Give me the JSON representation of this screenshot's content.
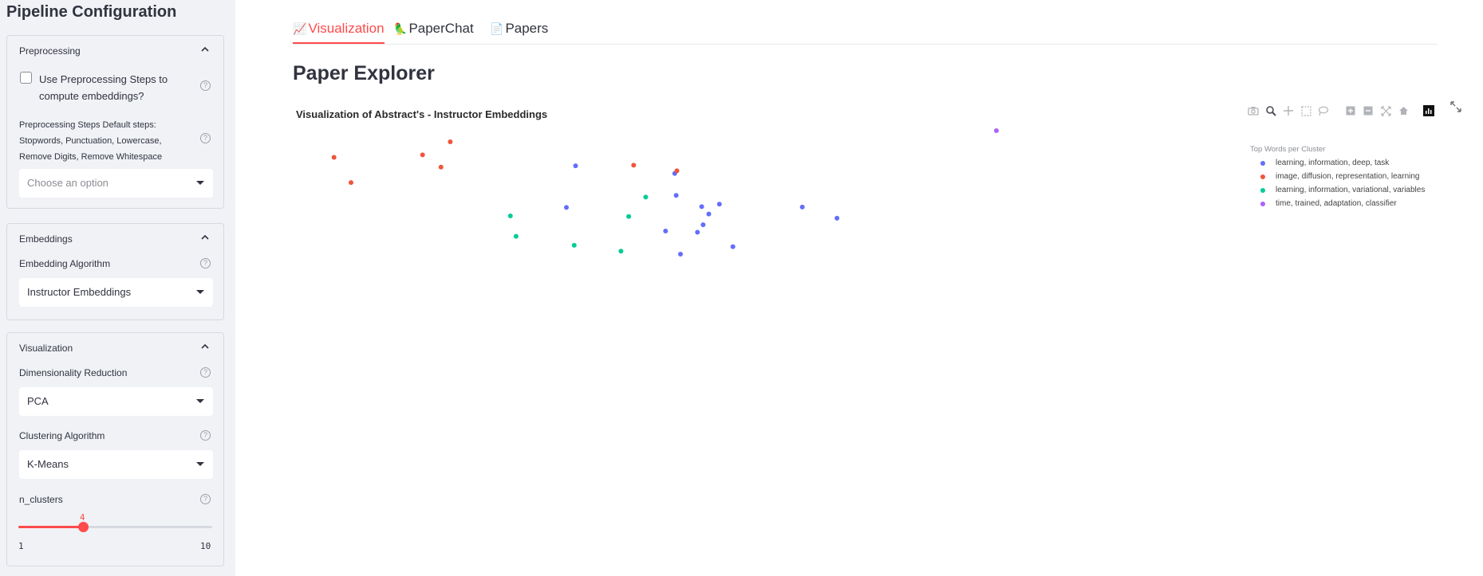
{
  "sidebar": {
    "title": "Pipeline Configuration",
    "preprocessing": {
      "header": "Preprocessing",
      "checkbox_label": "Use Preprocessing Steps to compute embeddings?",
      "checkbox_label_line1": "Use Preprocessing Steps to",
      "checkbox_label_line2": "compute embeddings?",
      "checked": false,
      "steps_label_line1": "Preprocessing Steps Default steps:",
      "steps_label_line2": "Stopwords, Punctuation, Lowercase,",
      "steps_label_line3": "Remove Digits, Remove Whitespace",
      "select_placeholder": "Choose an option"
    },
    "embeddings": {
      "header": "Embeddings",
      "algo_label": "Embedding Algorithm",
      "algo_value": "Instructor Embeddings"
    },
    "visualization": {
      "header": "Visualization",
      "dimred_label": "Dimensionality Reduction",
      "dimred_value": "PCA",
      "cluster_label": "Clustering Algorithm",
      "cluster_value": "K-Means",
      "nclusters_label": "n_clusters",
      "nclusters_value": "4",
      "nclusters_min": "1",
      "nclusters_max": "10",
      "nclusters_fraction": 0.333
    }
  },
  "tabs": [
    {
      "icon": "chart-icon",
      "glyph": "📈",
      "label": "Visualization",
      "active": true
    },
    {
      "icon": "parrot-icon",
      "glyph": "🦜",
      "label": "PaperChat",
      "active": false
    },
    {
      "icon": "page-icon",
      "glyph": "📄",
      "label": "Papers",
      "active": false
    }
  ],
  "page_title": "Paper Explorer",
  "colors": {
    "accent": "#ff4b4b",
    "cluster0": "#636efa",
    "cluster1": "#ef553b",
    "cluster2": "#00cc96",
    "cluster3": "#ab63fa"
  },
  "chart_data": {
    "type": "scatter",
    "title": "Visualization of Abstract's - Instructor Embeddings",
    "legend_title": "Top Words per Cluster",
    "legend_position": "top-right",
    "grid": false,
    "axes_visible": false,
    "xlim": [
      0,
      100
    ],
    "ylim": [
      0,
      100
    ],
    "series": [
      {
        "name": "learning, information, deep, task",
        "color": "#636efa",
        "points": [
          [
            40.6,
            81.7
          ],
          [
            54.6,
            77.7
          ],
          [
            54.8,
            66.3
          ],
          [
            60.9,
            61.7
          ],
          [
            58.4,
            60.4
          ],
          [
            39.3,
            60.0
          ],
          [
            59.4,
            56.6
          ],
          [
            72.6,
            60.2
          ],
          [
            77.5,
            54.4
          ],
          [
            58.6,
            51.0
          ],
          [
            53.3,
            47.7
          ],
          [
            57.8,
            47.1
          ],
          [
            62.8,
            39.6
          ],
          [
            55.4,
            35.7
          ]
        ]
      },
      {
        "name": "image, diffusion, representation, learning",
        "color": "#ef553b",
        "points": [
          [
            22.9,
            94.2
          ],
          [
            6.5,
            86.1
          ],
          [
            19.0,
            87.4
          ],
          [
            21.6,
            81.0
          ],
          [
            8.9,
            73.0
          ],
          [
            48.8,
            82.0
          ],
          [
            54.9,
            79.1
          ]
        ]
      },
      {
        "name": "learning, information, variational, variables",
        "color": "#00cc96",
        "points": [
          [
            50.5,
            65.4
          ],
          [
            31.4,
            55.6
          ],
          [
            48.1,
            55.3
          ],
          [
            32.2,
            45.0
          ],
          [
            40.4,
            40.3
          ],
          [
            47.0,
            37.2
          ]
        ]
      },
      {
        "name": "time, trained, adaptation, classifier",
        "color": "#ab63fa",
        "points": [
          [
            100.0,
            100.0
          ]
        ]
      }
    ]
  }
}
